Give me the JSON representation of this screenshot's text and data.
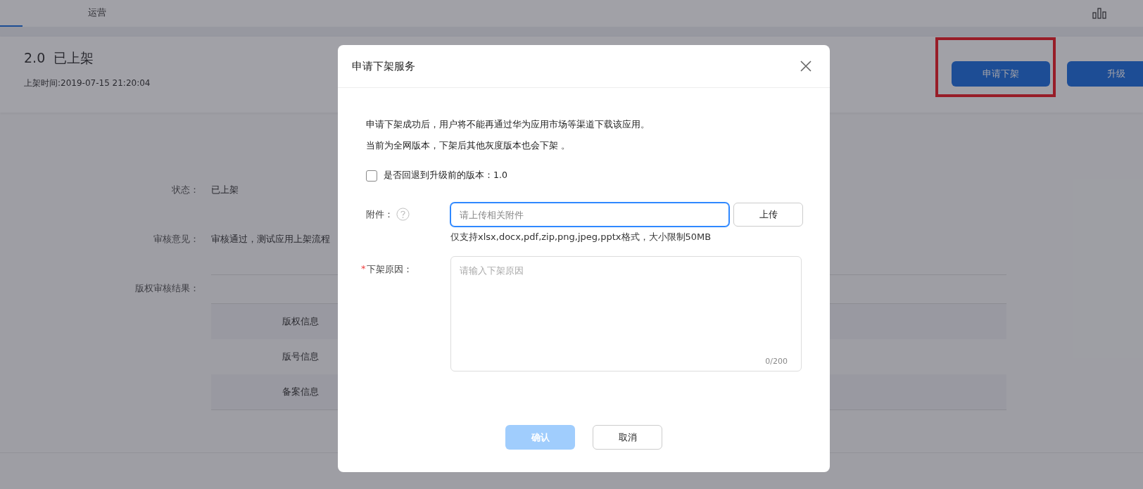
{
  "top_nav": {
    "tabs": [
      {
        "selected": true
      },
      {
        "label": "运营",
        "selected": false
      }
    ]
  },
  "header": {
    "title": "2.0  已上架",
    "release_time": "上架时间:2019-07-15 21:20:04",
    "buttons": [
      {
        "label": "申请下架",
        "highlighted": true
      },
      {
        "label": "升级",
        "highlighted": false
      }
    ]
  },
  "details": {
    "fields": [
      {
        "label": "状态：",
        "value": "已上架"
      },
      {
        "label": "审核意见：",
        "value": "审核通过，测试应用上架流程"
      },
      {
        "label": "版权审核结果："
      }
    ],
    "copyright_rows": [
      {
        "label": "版权信息"
      },
      {
        "label": "版号信息"
      },
      {
        "label": "备案信息"
      }
    ]
  },
  "dialog": {
    "title": "申请下架服务",
    "messages": [
      "申请下架成功后，用户将不能再通过华为应用市场等渠道下载该应用。",
      "当前为全网版本，下架后其他灰度版本也会下架 。"
    ],
    "rollback": {
      "label": "是否回退到升级前的版本：1.0",
      "checked": false
    },
    "attachment": {
      "label": "附件：",
      "placeholder": "请上传相关附件",
      "focused": true,
      "upload": "上传",
      "hint": "仅支持xlsx,docx,pdf,zip,png,jpeg,pptx格式，大小限制50MB"
    },
    "reason": {
      "required_mark": "*",
      "label": "下架原因：",
      "placeholder": "请输入下架原因",
      "counter": "0/200"
    },
    "buttons": [
      {
        "label": "确认",
        "kind": "primary",
        "disabled": true
      },
      {
        "label": "取消",
        "kind": "default",
        "disabled": false
      }
    ]
  }
}
